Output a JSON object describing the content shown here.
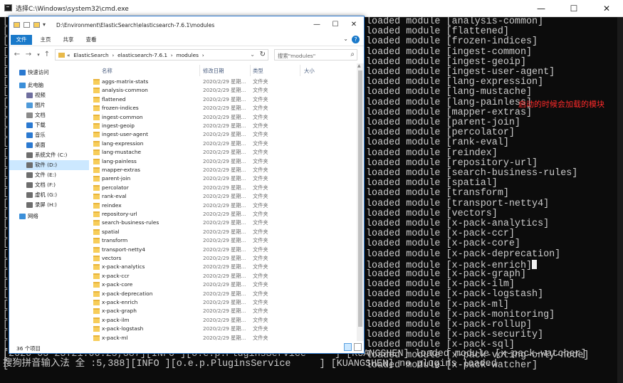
{
  "cmd": {
    "title": "选择C:\\Windows\\system32\\cmd.exe",
    "annotation": "启动的时候会加载的模块",
    "module_lines": [
      "loaded module [analysis-common]",
      "loaded module [flattened]",
      "loaded module [frozen-indices]",
      "loaded module [ingest-common]",
      "loaded module [ingest-geoip]",
      "loaded module [ingest-user-agent]",
      "loaded module [lang-expression]",
      "loaded module [lang-mustache]",
      "loaded module [lang-painless]",
      "loaded module [mapper-extras]",
      "loaded module [parent-join]",
      "loaded module [percolator]",
      "loaded module [rank-eval]",
      "loaded module [reindex]",
      "loaded module [repository-url]",
      "loaded module [search-business-rules]",
      "loaded module [spatial]",
      "loaded module [transform]",
      "loaded module [transport-netty4]",
      "loaded module [vectors]",
      "loaded module [x-pack-analytics]",
      "loaded module [x-pack-ccr]",
      "loaded module [x-pack-core]",
      "loaded module [x-pack-deprecation]",
      "loaded module [x-pack-enrich]",
      "loaded module [x-pack-graph]",
      "loaded module [x-pack-ilm]",
      "loaded module [x-pack-logstash]",
      "loaded module [x-pack-ml]",
      "loaded module [x-pack-monitoring]",
      "loaded module [x-pack-rollup]",
      "loaded module [x-pack-security]",
      "loaded module [x-pack-sql]",
      "loaded module [x-pack-voting-only-node]",
      "loaded module [x-pack-watcher]"
    ],
    "bottom_lines": [
      "[2020-05-23T21:00:25,387][INFO ][o.e.p.PluginsService     ] [KUANGSHEN] loaded module [x-pack-watcher]",
      "搜狗拼音输入法 全 :5,388][INFO ][o.e.p.PluginsService     ] [KUANGSHEN] no plugins loaded"
    ]
  },
  "explorer": {
    "title": "D:\\Environment\\ElasticSearch\\elasticsearch-7.6.1\\modules",
    "ribbon_tabs": [
      "文件",
      "主页",
      "共享",
      "查看"
    ],
    "address_path": "«  ElasticSearch  ›  elasticsearch-7.6.1  ›  modules  ›",
    "search_placeholder": "搜索\"modules\"",
    "columns": [
      "名称",
      "修改日期",
      "类型",
      "大小"
    ],
    "nav": [
      {
        "label": "快速访问",
        "icon": "star-icon"
      },
      {
        "label": "此电脑",
        "icon": "pc-icon"
      },
      {
        "label": "视频",
        "icon": "video-icon"
      },
      {
        "label": "图片",
        "icon": "picture-icon"
      },
      {
        "label": "文档",
        "icon": "document-icon"
      },
      {
        "label": "下载",
        "icon": "download-icon"
      },
      {
        "label": "音乐",
        "icon": "music-icon"
      },
      {
        "label": "桌面",
        "icon": "desktop-icon"
      },
      {
        "label": "系统文件 (C:)",
        "icon": "drive-icon"
      },
      {
        "label": "软件 (D:)",
        "icon": "drive-icon"
      },
      {
        "label": "文件 (E:)",
        "icon": "drive-icon"
      },
      {
        "label": "文档 (F:)",
        "icon": "drive-icon"
      },
      {
        "label": "虚机 (G:)",
        "icon": "drive-icon"
      },
      {
        "label": "录屏 (H:)",
        "icon": "drive-icon"
      },
      {
        "label": "网络",
        "icon": "network-icon"
      }
    ],
    "files": [
      {
        "name": "aggs-matrix-stats",
        "date": "2020/2/29 星期...",
        "type": "文件夹"
      },
      {
        "name": "analysis-common",
        "date": "2020/2/29 星期...",
        "type": "文件夹"
      },
      {
        "name": "flattened",
        "date": "2020/2/29 星期...",
        "type": "文件夹"
      },
      {
        "name": "frozen-indices",
        "date": "2020/2/29 星期...",
        "type": "文件夹"
      },
      {
        "name": "ingest-common",
        "date": "2020/2/29 星期...",
        "type": "文件夹"
      },
      {
        "name": "ingest-geoip",
        "date": "2020/2/29 星期...",
        "type": "文件夹"
      },
      {
        "name": "ingest-user-agent",
        "date": "2020/2/29 星期...",
        "type": "文件夹"
      },
      {
        "name": "lang-expression",
        "date": "2020/2/29 星期...",
        "type": "文件夹"
      },
      {
        "name": "lang-mustache",
        "date": "2020/2/29 星期...",
        "type": "文件夹"
      },
      {
        "name": "lang-painless",
        "date": "2020/2/29 星期...",
        "type": "文件夹"
      },
      {
        "name": "mapper-extras",
        "date": "2020/2/29 星期...",
        "type": "文件夹"
      },
      {
        "name": "parent-join",
        "date": "2020/2/29 星期...",
        "type": "文件夹"
      },
      {
        "name": "percolator",
        "date": "2020/2/29 星期...",
        "type": "文件夹"
      },
      {
        "name": "rank-eval",
        "date": "2020/2/29 星期...",
        "type": "文件夹"
      },
      {
        "name": "reindex",
        "date": "2020/2/29 星期...",
        "type": "文件夹"
      },
      {
        "name": "repository-url",
        "date": "2020/2/29 星期...",
        "type": "文件夹"
      },
      {
        "name": "search-business-rules",
        "date": "2020/2/29 星期...",
        "type": "文件夹"
      },
      {
        "name": "spatial",
        "date": "2020/2/29 星期...",
        "type": "文件夹"
      },
      {
        "name": "transform",
        "date": "2020/2/29 星期...",
        "type": "文件夹"
      },
      {
        "name": "transport-netty4",
        "date": "2020/2/29 星期...",
        "type": "文件夹"
      },
      {
        "name": "vectors",
        "date": "2020/2/29 星期...",
        "type": "文件夹"
      },
      {
        "name": "x-pack-analytics",
        "date": "2020/2/29 星期...",
        "type": "文件夹"
      },
      {
        "name": "x-pack-ccr",
        "date": "2020/2/29 星期...",
        "type": "文件夹"
      },
      {
        "name": "x-pack-core",
        "date": "2020/2/29 星期...",
        "type": "文件夹"
      },
      {
        "name": "x-pack-deprecation",
        "date": "2020/2/29 星期...",
        "type": "文件夹"
      },
      {
        "name": "x-pack-enrich",
        "date": "2020/2/29 星期...",
        "type": "文件夹"
      },
      {
        "name": "x-pack-graph",
        "date": "2020/2/29 星期...",
        "type": "文件夹"
      },
      {
        "name": "x-pack-ilm",
        "date": "2020/2/29 星期...",
        "type": "文件夹"
      },
      {
        "name": "x-pack-logstash",
        "date": "2020/2/29 星期...",
        "type": "文件夹"
      },
      {
        "name": "x-pack-ml",
        "date": "2020/2/29 星期...",
        "type": "文件夹"
      },
      {
        "name": "x-pack-monitoring",
        "date": "2020/2/29 星期...",
        "type": "文件夹"
      },
      {
        "name": "x-pack-rollup",
        "date": "2020/2/29 星期...",
        "type": "文件夹"
      }
    ],
    "status": "36 个项目"
  },
  "colors": {
    "console_bg": "#0c0c0c",
    "console_text": "#cccccc",
    "annotation": "#ff2a2a",
    "accent": "#1979ca",
    "folder": "#f7cd5a",
    "selected": "#cce8ff"
  }
}
